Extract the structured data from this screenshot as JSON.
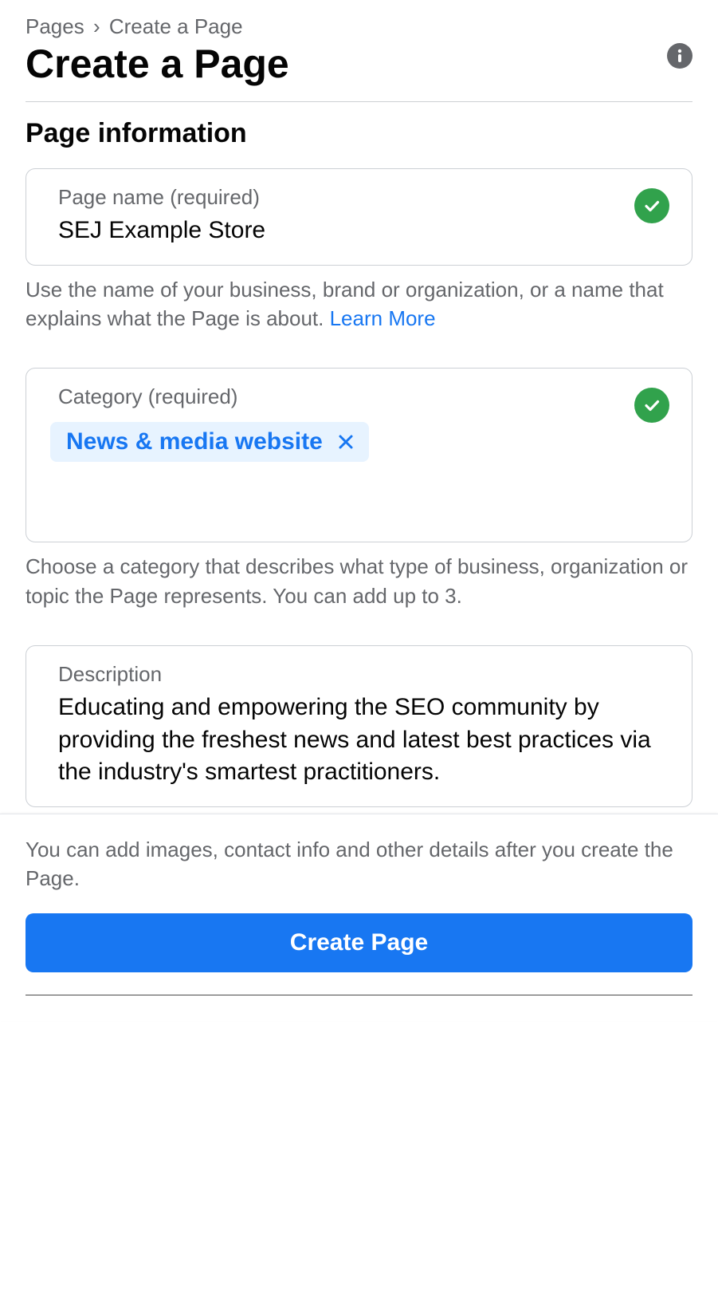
{
  "breadcrumb": {
    "root": "Pages",
    "current": "Create a Page"
  },
  "page": {
    "title": "Create a Page"
  },
  "section": {
    "title": "Page information"
  },
  "pageName": {
    "label": "Page name (required)",
    "value": "SEJ Example Store",
    "helper": "Use the name of your business, brand or organization, or a name that explains what the Page is about. ",
    "learnMore": "Learn More"
  },
  "category": {
    "label": "Category (required)",
    "tag": "News & media website",
    "helper": "Choose a category that describes what type of business, organization or topic the Page represents. You can add up to 3."
  },
  "description": {
    "label": "Description",
    "value": "Educating and empowering the SEO community by providing the freshest news and latest best practices via the industry's smartest practitioners."
  },
  "footer": {
    "text": "You can add images, contact info and other details after you create the Page.",
    "button": "Create Page"
  }
}
